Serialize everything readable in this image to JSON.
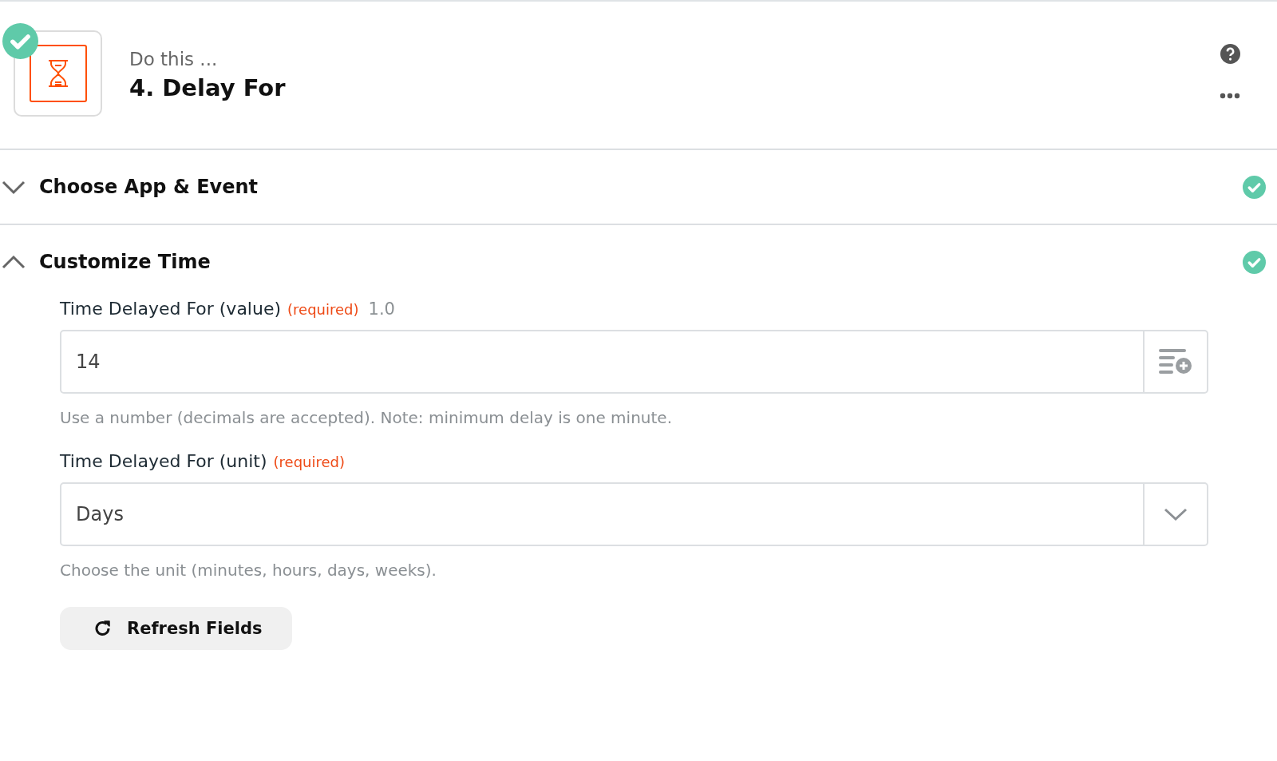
{
  "step": {
    "completed": true,
    "eyebrow": "Do this ...",
    "title": "4. Delay For"
  },
  "sections": [
    {
      "title": "Choose App & Event",
      "expanded": false,
      "completed": true
    },
    {
      "title": "Customize Time",
      "expanded": true,
      "completed": true,
      "fields": [
        {
          "kind": "input",
          "label": "Time Delayed For (value)",
          "required": "(required)",
          "version": "1.0",
          "value": "14",
          "help": "Use a number (decimals are accepted). Note: minimum delay is one minute."
        },
        {
          "kind": "select",
          "label": "Time Delayed For (unit)",
          "required": "(required)",
          "value": "Days",
          "help": "Choose the unit (minutes, hours, days, weeks)."
        }
      ],
      "button": "Refresh Fields"
    }
  ]
}
